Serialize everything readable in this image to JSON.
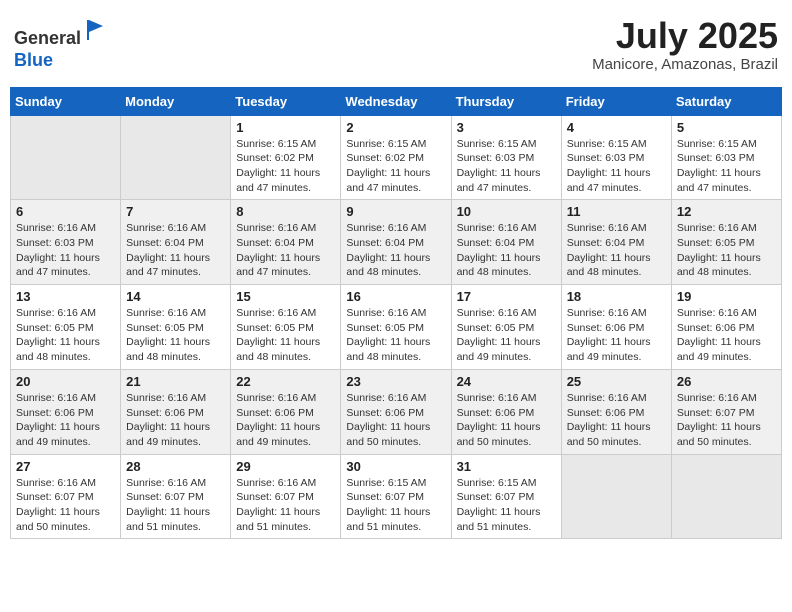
{
  "header": {
    "logo_line1": "General",
    "logo_line2": "Blue",
    "month_title": "July 2025",
    "location": "Manicore, Amazonas, Brazil"
  },
  "weekdays": [
    "Sunday",
    "Monday",
    "Tuesday",
    "Wednesday",
    "Thursday",
    "Friday",
    "Saturday"
  ],
  "weeks": [
    [
      {
        "day": "",
        "info": ""
      },
      {
        "day": "",
        "info": ""
      },
      {
        "day": "1",
        "info": "Sunrise: 6:15 AM\nSunset: 6:02 PM\nDaylight: 11 hours and 47 minutes."
      },
      {
        "day": "2",
        "info": "Sunrise: 6:15 AM\nSunset: 6:02 PM\nDaylight: 11 hours and 47 minutes."
      },
      {
        "day": "3",
        "info": "Sunrise: 6:15 AM\nSunset: 6:03 PM\nDaylight: 11 hours and 47 minutes."
      },
      {
        "day": "4",
        "info": "Sunrise: 6:15 AM\nSunset: 6:03 PM\nDaylight: 11 hours and 47 minutes."
      },
      {
        "day": "5",
        "info": "Sunrise: 6:15 AM\nSunset: 6:03 PM\nDaylight: 11 hours and 47 minutes."
      }
    ],
    [
      {
        "day": "6",
        "info": "Sunrise: 6:16 AM\nSunset: 6:03 PM\nDaylight: 11 hours and 47 minutes."
      },
      {
        "day": "7",
        "info": "Sunrise: 6:16 AM\nSunset: 6:04 PM\nDaylight: 11 hours and 47 minutes."
      },
      {
        "day": "8",
        "info": "Sunrise: 6:16 AM\nSunset: 6:04 PM\nDaylight: 11 hours and 47 minutes."
      },
      {
        "day": "9",
        "info": "Sunrise: 6:16 AM\nSunset: 6:04 PM\nDaylight: 11 hours and 48 minutes."
      },
      {
        "day": "10",
        "info": "Sunrise: 6:16 AM\nSunset: 6:04 PM\nDaylight: 11 hours and 48 minutes."
      },
      {
        "day": "11",
        "info": "Sunrise: 6:16 AM\nSunset: 6:04 PM\nDaylight: 11 hours and 48 minutes."
      },
      {
        "day": "12",
        "info": "Sunrise: 6:16 AM\nSunset: 6:05 PM\nDaylight: 11 hours and 48 minutes."
      }
    ],
    [
      {
        "day": "13",
        "info": "Sunrise: 6:16 AM\nSunset: 6:05 PM\nDaylight: 11 hours and 48 minutes."
      },
      {
        "day": "14",
        "info": "Sunrise: 6:16 AM\nSunset: 6:05 PM\nDaylight: 11 hours and 48 minutes."
      },
      {
        "day": "15",
        "info": "Sunrise: 6:16 AM\nSunset: 6:05 PM\nDaylight: 11 hours and 48 minutes."
      },
      {
        "day": "16",
        "info": "Sunrise: 6:16 AM\nSunset: 6:05 PM\nDaylight: 11 hours and 48 minutes."
      },
      {
        "day": "17",
        "info": "Sunrise: 6:16 AM\nSunset: 6:05 PM\nDaylight: 11 hours and 49 minutes."
      },
      {
        "day": "18",
        "info": "Sunrise: 6:16 AM\nSunset: 6:06 PM\nDaylight: 11 hours and 49 minutes."
      },
      {
        "day": "19",
        "info": "Sunrise: 6:16 AM\nSunset: 6:06 PM\nDaylight: 11 hours and 49 minutes."
      }
    ],
    [
      {
        "day": "20",
        "info": "Sunrise: 6:16 AM\nSunset: 6:06 PM\nDaylight: 11 hours and 49 minutes."
      },
      {
        "day": "21",
        "info": "Sunrise: 6:16 AM\nSunset: 6:06 PM\nDaylight: 11 hours and 49 minutes."
      },
      {
        "day": "22",
        "info": "Sunrise: 6:16 AM\nSunset: 6:06 PM\nDaylight: 11 hours and 49 minutes."
      },
      {
        "day": "23",
        "info": "Sunrise: 6:16 AM\nSunset: 6:06 PM\nDaylight: 11 hours and 50 minutes."
      },
      {
        "day": "24",
        "info": "Sunrise: 6:16 AM\nSunset: 6:06 PM\nDaylight: 11 hours and 50 minutes."
      },
      {
        "day": "25",
        "info": "Sunrise: 6:16 AM\nSunset: 6:06 PM\nDaylight: 11 hours and 50 minutes."
      },
      {
        "day": "26",
        "info": "Sunrise: 6:16 AM\nSunset: 6:07 PM\nDaylight: 11 hours and 50 minutes."
      }
    ],
    [
      {
        "day": "27",
        "info": "Sunrise: 6:16 AM\nSunset: 6:07 PM\nDaylight: 11 hours and 50 minutes."
      },
      {
        "day": "28",
        "info": "Sunrise: 6:16 AM\nSunset: 6:07 PM\nDaylight: 11 hours and 51 minutes."
      },
      {
        "day": "29",
        "info": "Sunrise: 6:16 AM\nSunset: 6:07 PM\nDaylight: 11 hours and 51 minutes."
      },
      {
        "day": "30",
        "info": "Sunrise: 6:15 AM\nSunset: 6:07 PM\nDaylight: 11 hours and 51 minutes."
      },
      {
        "day": "31",
        "info": "Sunrise: 6:15 AM\nSunset: 6:07 PM\nDaylight: 11 hours and 51 minutes."
      },
      {
        "day": "",
        "info": ""
      },
      {
        "day": "",
        "info": ""
      }
    ]
  ]
}
